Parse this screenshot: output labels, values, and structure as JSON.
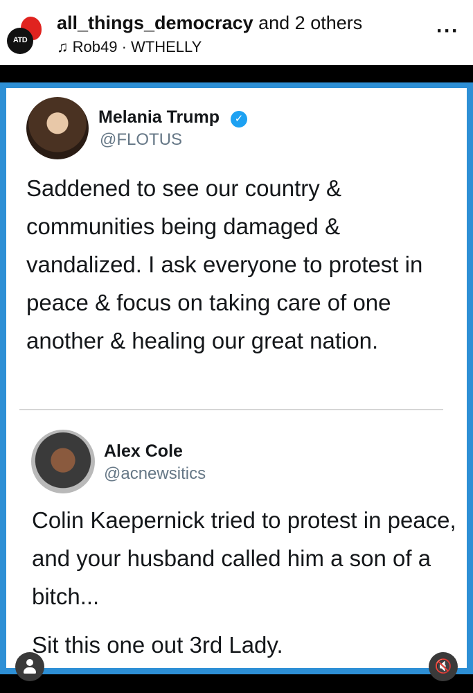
{
  "post_header": {
    "account": "all_things_democracy",
    "collab_suffix": " and 2 others",
    "audio": "Rob49 · WTHELLY",
    "avatar_logo_text": "ATD"
  },
  "tweet1": {
    "name": "Melania Trump",
    "handle": "@FLOTUS",
    "text": "Saddened to see our country & communities being damaged & vandalized. I ask everyone to protest in peace & focus on taking care of one another & healing our great nation."
  },
  "tweet2": {
    "name": "Alex Cole",
    "handle": "@acnewsitics",
    "text": "Colin Kaepernick tried to protest in peace, and your husband called him a son of a bitch...",
    "text_2": "Sit this one out 3rd Lady."
  },
  "icons": {
    "music": "music-note-icon",
    "more": "more-options-icon",
    "verified": "verified-badge-icon",
    "user_tag": "user-tag-icon",
    "mute": "speaker-muted-icon"
  },
  "colors": {
    "frame_blue": "#2d8fd5",
    "verified_blue": "#1da1f2",
    "handle_gray": "#657786"
  }
}
